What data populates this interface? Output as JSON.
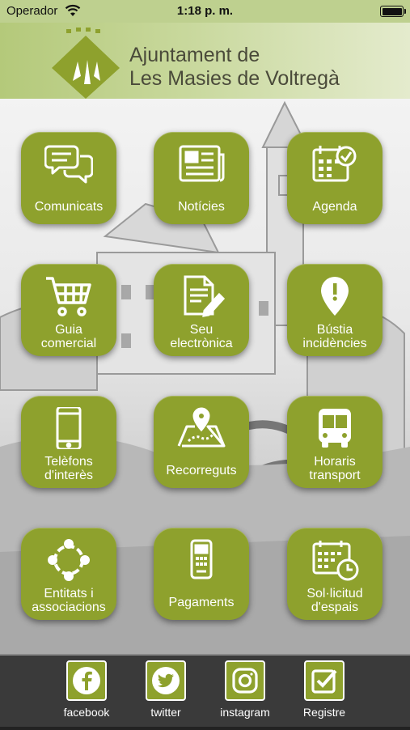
{
  "status_bar": {
    "carrier": "Operador",
    "time": "1:18 p. m."
  },
  "header": {
    "title_line1": "Ajuntament de",
    "title_line2": "Les Masies de Voltregà"
  },
  "colors": {
    "tile": "#8ea12d",
    "header": "#bed08f",
    "footer": "#3a3a3a"
  },
  "tiles": [
    {
      "label": [
        "Comunicats"
      ],
      "icon": "chat-bubbles-icon"
    },
    {
      "label": [
        "Notícies"
      ],
      "icon": "newspaper-icon"
    },
    {
      "label": [
        "Agenda"
      ],
      "icon": "calendar-check-icon"
    },
    {
      "label": [
        "Guia",
        "comercial"
      ],
      "icon": "shopping-cart-icon"
    },
    {
      "label": [
        "Seu",
        "electrònica"
      ],
      "icon": "document-pen-icon"
    },
    {
      "label": [
        "Bústia",
        "incidències"
      ],
      "icon": "map-pin-icon"
    },
    {
      "label": [
        "Telèfons",
        "d'interès"
      ],
      "icon": "smartphone-icon"
    },
    {
      "label": [
        "Recorreguts"
      ],
      "icon": "map-route-icon"
    },
    {
      "label": [
        "Horaris",
        "transport"
      ],
      "icon": "bus-icon"
    },
    {
      "label": [
        "Entitats i",
        "associacions"
      ],
      "icon": "people-circle-icon"
    },
    {
      "label": [
        "Pagaments"
      ],
      "icon": "card-terminal-icon"
    },
    {
      "label": [
        "Sol·licitud",
        "d'espais"
      ],
      "icon": "calendar-clock-icon"
    }
  ],
  "footer": {
    "items": [
      {
        "label": "facebook",
        "icon": "facebook-icon"
      },
      {
        "label": "twitter",
        "icon": "twitter-icon"
      },
      {
        "label": "instagram",
        "icon": "instagram-icon"
      },
      {
        "label": "Registre",
        "icon": "checkbox-icon"
      }
    ]
  }
}
